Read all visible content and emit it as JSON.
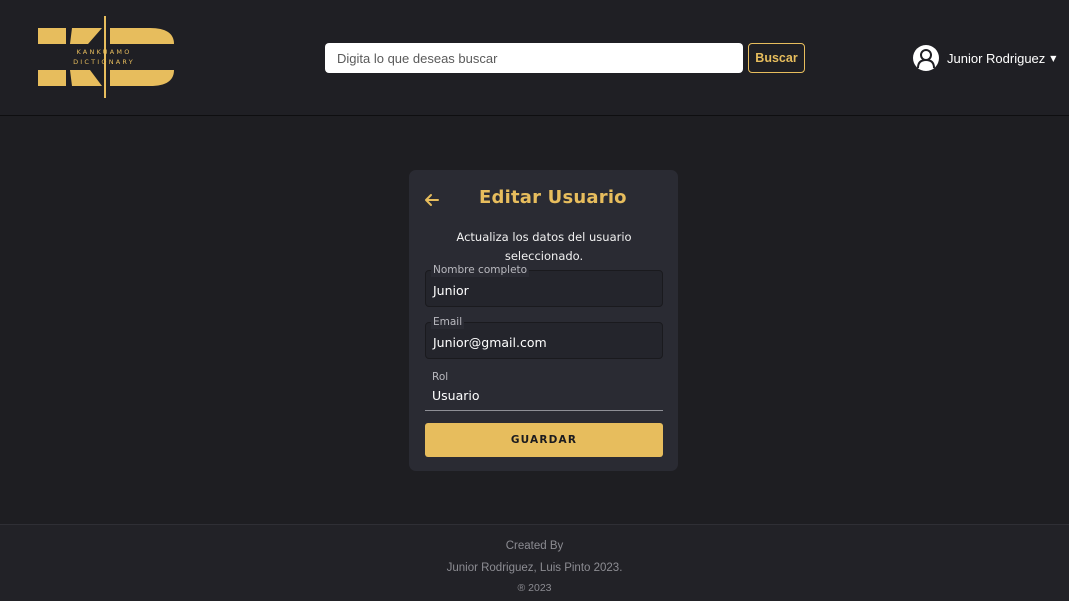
{
  "header": {
    "logo": {
      "letters": "KD",
      "line1": "KANKUAMO",
      "line2": "DICTIONARY",
      "color": "#e7bd5d"
    },
    "search": {
      "placeholder": "Digita lo que deseas buscar",
      "button_label": "Buscar"
    },
    "user": {
      "name": "Junior Rodriguez",
      "avatar_icon": "user-avatar-icon",
      "caret_icon": "caret-down-icon"
    }
  },
  "card": {
    "back_icon": "arrow-left-icon",
    "title": "Editar Usuario",
    "subtitle": "Actualiza los datos del usuario seleccionado.",
    "fields": {
      "name": {
        "label": "Nombre completo",
        "value": "Junior"
      },
      "email": {
        "label": "Email",
        "value": "Junior@gmail.com"
      },
      "role": {
        "label": "Rol",
        "value": "Usuario"
      }
    },
    "save_label": "GUARDAR"
  },
  "footer": {
    "line1": "Created By",
    "line2": "Junior Rodriguez, Luis Pinto 2023.",
    "line3": "® 2023"
  },
  "colors": {
    "accent": "#e7bd5d",
    "background": "#1e1e22",
    "card": "#2a2b33"
  }
}
